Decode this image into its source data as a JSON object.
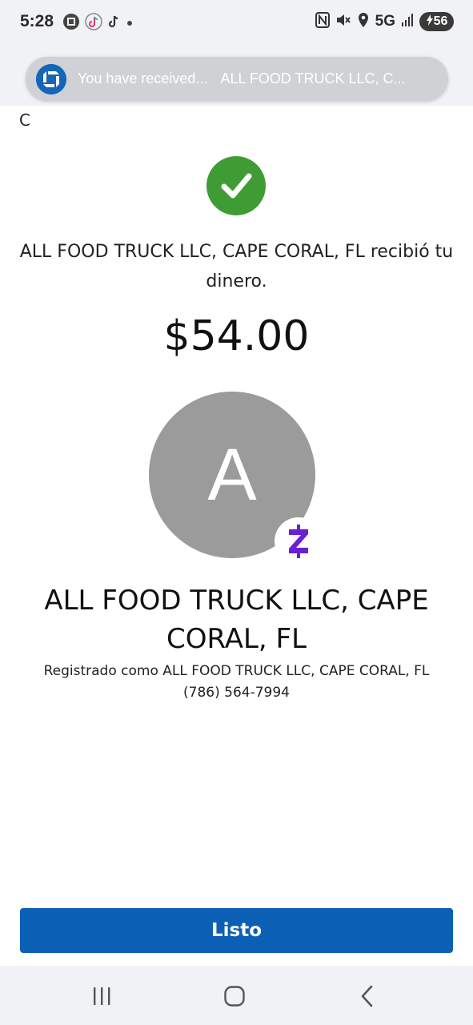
{
  "status_bar": {
    "time": "5:28",
    "network": "5G",
    "battery": "56",
    "left_icons": [
      "chase-icon",
      "tiktok-icon",
      "tiktok-icon",
      "dot-icon"
    ],
    "right_icons": [
      "nfc-icon",
      "mute-icon",
      "location-icon",
      "signal-icon"
    ]
  },
  "header": {
    "peek_char": "C"
  },
  "notification": {
    "title": "You have received...",
    "body": "ALL FOOD TRUCK LLC, C..."
  },
  "confirmation": {
    "message": "ALL FOOD TRUCK LLC, CAPE CORAL, FL recibió tu dinero.",
    "amount": "$54.00"
  },
  "recipient": {
    "avatar_letter": "A",
    "name": "ALL FOOD TRUCK LLC, CAPE CORAL, FL",
    "registered_as": "Registrado como ALL FOOD TRUCK LLC, CAPE CORAL, FL",
    "phone": "(786) 564-7994"
  },
  "actions": {
    "done_label": "Listo"
  },
  "colors": {
    "success_green": "#3f9c34",
    "primary_blue": "#0b5fb5",
    "zelle_purple": "#6d1ed4",
    "avatar_gray": "#9b9b9b"
  }
}
